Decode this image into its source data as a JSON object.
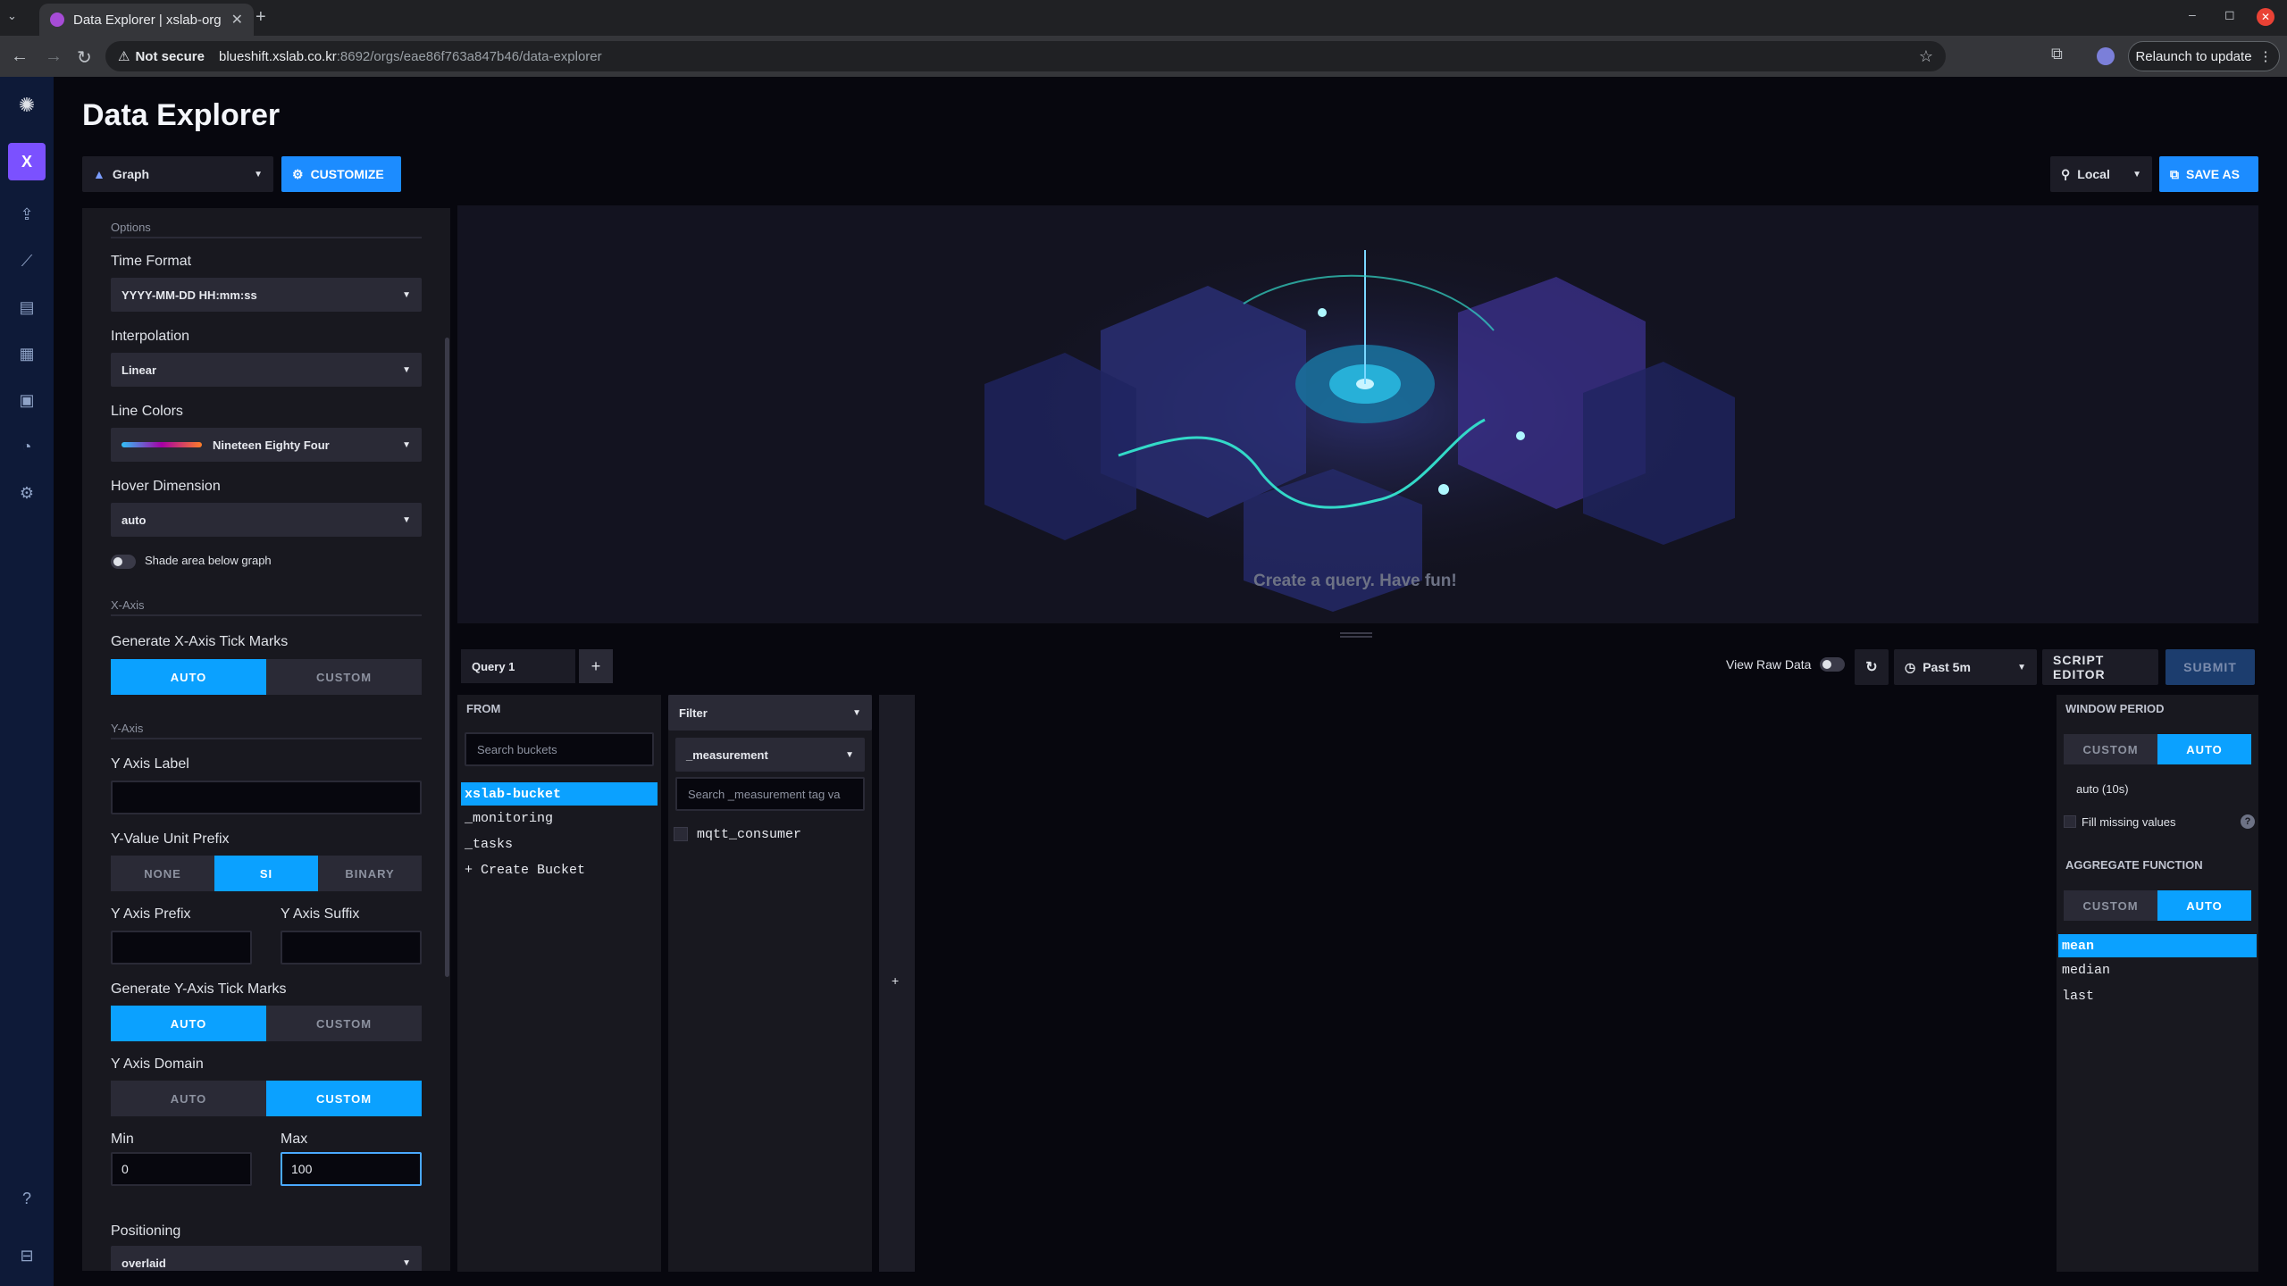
{
  "browser": {
    "tab_title": "Data Explorer | xslab-org",
    "tab_close": "✕",
    "new_tab": "+",
    "security": "Not secure",
    "url_host": "blueshift.xslab.co.kr",
    "url_path": ":8692/orgs/eae86f763a847b46/data-explorer",
    "relaunch": "Relaunch to update",
    "window_controls": [
      "–",
      "◻",
      "✕"
    ]
  },
  "nav": {
    "org_initial": "X"
  },
  "page": {
    "title": "Data Explorer"
  },
  "toolbar": {
    "vis_type": "Graph",
    "customize": "CUSTOMIZE",
    "timezone": "Local",
    "save_as": "SAVE AS"
  },
  "options": {
    "header": "Options",
    "time_format_label": "Time Format",
    "time_format_value": "YYYY-MM-DD HH:mm:ss",
    "interpolation_label": "Interpolation",
    "interpolation_value": "Linear",
    "line_colors_label": "Line Colors",
    "line_colors_value": "Nineteen Eighty Four",
    "hover_label": "Hover Dimension",
    "hover_value": "auto",
    "shade_label": "Shade area below graph",
    "xaxis_header": "X-Axis",
    "x_tick_label": "Generate X-Axis Tick Marks",
    "x_tick_options": [
      "AUTO",
      "CUSTOM"
    ],
    "yaxis_header": "Y-Axis",
    "y_axis_label_label": "Y Axis Label",
    "y_axis_label_value": "",
    "y_unit_label": "Y-Value Unit Prefix",
    "y_unit_options": [
      "NONE",
      "SI",
      "BINARY"
    ],
    "y_prefix_label": "Y Axis Prefix",
    "y_suffix_label": "Y Axis Suffix",
    "y_tick_label": "Generate Y-Axis Tick Marks",
    "y_tick_options": [
      "AUTO",
      "CUSTOM"
    ],
    "y_domain_label": "Y Axis Domain",
    "y_domain_options": [
      "AUTO",
      "CUSTOM"
    ],
    "min_label": "Min",
    "min_value": "0",
    "max_label": "Max",
    "max_value": "100",
    "positioning_label": "Positioning",
    "positioning_value": "overlaid"
  },
  "graph": {
    "empty_message": "Create a query. Have fun!"
  },
  "query": {
    "tab": "Query 1",
    "add": "+",
    "view_raw": "View Raw Data",
    "time_range": "Past 5m",
    "script_editor": "SCRIPT EDITOR",
    "submit": "SUBMIT"
  },
  "from": {
    "header": "FROM",
    "search_placeholder": "Search buckets",
    "buckets": [
      "xslab-bucket",
      "_monitoring",
      "_tasks",
      "+ Create Bucket"
    ]
  },
  "filter": {
    "header": "Filter",
    "key": "_measurement",
    "search_placeholder": "Search _measurement tag va",
    "values": [
      "mqtt_consumer"
    ]
  },
  "add_filter": "+",
  "window": {
    "header": "WINDOW PERIOD",
    "options": [
      "CUSTOM",
      "AUTO"
    ],
    "auto_value": "auto (10s)",
    "fill_missing": "Fill missing values",
    "help": "?",
    "agg_header": "AGGREGATE FUNCTION",
    "agg_options": [
      "CUSTOM",
      "AUTO"
    ],
    "functions": [
      "mean",
      "median",
      "last"
    ]
  },
  "colors": {
    "accent": "#0ba1ff",
    "save": "#1c8cff",
    "nav": "#0e1a38"
  }
}
